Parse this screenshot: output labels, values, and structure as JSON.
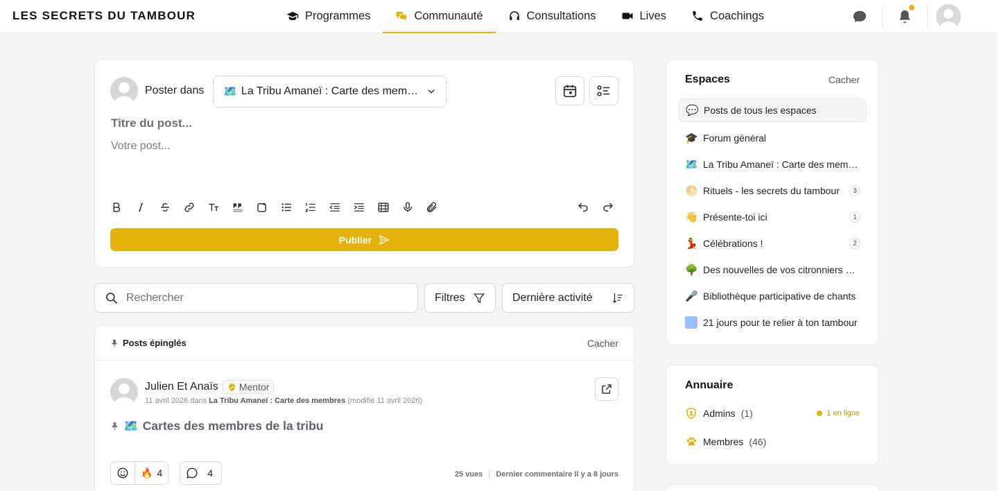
{
  "brand": "LES SECRETS DU TAMBOUR",
  "nav": [
    {
      "label": "Programmes",
      "icon": "graduation-cap-icon",
      "active": false
    },
    {
      "label": "Communauté",
      "icon": "chat-bubbles-icon",
      "active": true
    },
    {
      "label": "Consultations",
      "icon": "headset-icon",
      "active": false
    },
    {
      "label": "Lives",
      "icon": "video-camera-icon",
      "active": false
    },
    {
      "label": "Coachings",
      "icon": "phone-icon",
      "active": false
    }
  ],
  "composer": {
    "poster_label": "Poster dans",
    "space_emoji": "🗺️",
    "selected_space": "La Tribu Amaneï : Carte des membres",
    "title_placeholder": "Titre du post...",
    "body_placeholder": "Votre post...",
    "publish_label": "Publier"
  },
  "search": {
    "placeholder": "Rechercher"
  },
  "filters_label": "Filtres",
  "sort_label": "Dernière activité",
  "pinned": {
    "title": "Posts épinglés",
    "hide_label": "Cacher",
    "post": {
      "author": "Julien Et Anaïs",
      "badge": "Mentor",
      "date": "11 avril 2026 dans",
      "space": "La Tribu Amaneï : Carte des membres",
      "modified": "(modifié 11 avril 2026)",
      "title_emoji": "🗺️",
      "title": "Cartes des membres de la tribu",
      "reaction_emoji": "🔥",
      "reaction_count": "4",
      "comment_count": "4",
      "views": "25 vues",
      "last_comment": "Dernier commentaire Il y a 8 jours"
    }
  },
  "espaces": {
    "title": "Espaces",
    "hide_label": "Cacher",
    "items": [
      {
        "emoji": "💬",
        "label": "Posts de tous les espaces",
        "count": ""
      },
      {
        "emoji": "🎓",
        "label": "Forum général",
        "count": ""
      },
      {
        "emoji": "🗺️",
        "label": "La Tribu Amaneï : Carte des membres",
        "count": ""
      },
      {
        "emoji": "🌕",
        "label": "Rituels - les secrets du tambour",
        "count": "3"
      },
      {
        "emoji": "👋",
        "label": "Présente-toi ici",
        "count": "1"
      },
      {
        "emoji": "💃",
        "label": "Célébrations !",
        "count": "2"
      },
      {
        "emoji": "🌳",
        "label": "Des nouvelles de vos citronniers et de vos tambours",
        "count": ""
      },
      {
        "emoji": "🎤",
        "label": "Bibliothèque participative de chants",
        "count": ""
      },
      {
        "emoji": "",
        "label": "21 jours pour te relier à ton tambour",
        "count": ""
      }
    ]
  },
  "annuaire": {
    "title": "Annuaire",
    "admins_label": "Admins",
    "admins_count": "(1)",
    "online_label": "1 en ligne",
    "members_label": "Membres",
    "members_count": "(46)"
  },
  "colors": {
    "accent": "#e6b10b",
    "space_square": "#9bbdf8"
  }
}
